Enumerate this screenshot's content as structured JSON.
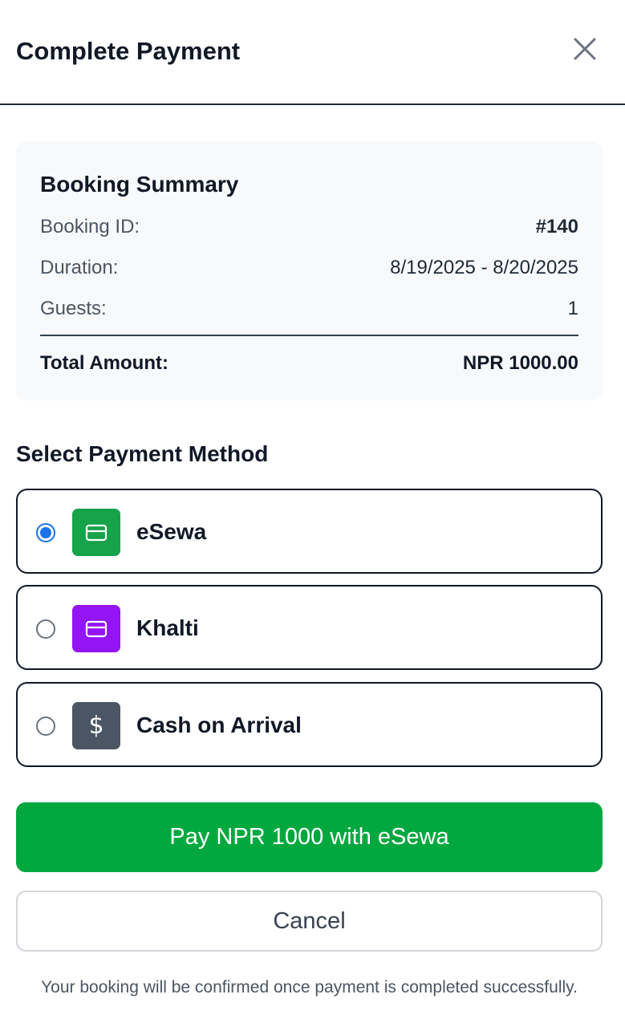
{
  "modal": {
    "title": "Complete Payment",
    "close_icon": "close-icon"
  },
  "summary": {
    "title": "Booking Summary",
    "rows": [
      {
        "label": "Booking ID:",
        "value": "#140"
      },
      {
        "label": "Duration:",
        "value": "8/19/2025 - 8/20/2025"
      },
      {
        "label": "Guests:",
        "value": "1"
      }
    ],
    "total": {
      "label": "Total Amount:",
      "value": "NPR 1000.00"
    }
  },
  "payment": {
    "section_title": "Select Payment Method",
    "selected": "eSewa",
    "options": [
      {
        "label": "eSewa",
        "icon": "credit-card-icon",
        "color": "#16a34a",
        "checked": true
      },
      {
        "label": "Khalti",
        "icon": "credit-card-icon",
        "color": "#9314f5",
        "checked": false
      },
      {
        "label": "Cash on Arrival",
        "icon": "dollar-icon",
        "glyph": "$",
        "color": "#4b5563",
        "checked": false
      }
    ]
  },
  "actions": {
    "pay_label": "Pay NPR 1000 with eSewa",
    "cancel_label": "Cancel"
  },
  "footer_note": "Your booking will be confirmed once payment is completed successfully.",
  "colors": {
    "primary_green": "#01a83f",
    "radio_blue": "#1a73e8",
    "summary_bg": "#f8f9fb"
  }
}
